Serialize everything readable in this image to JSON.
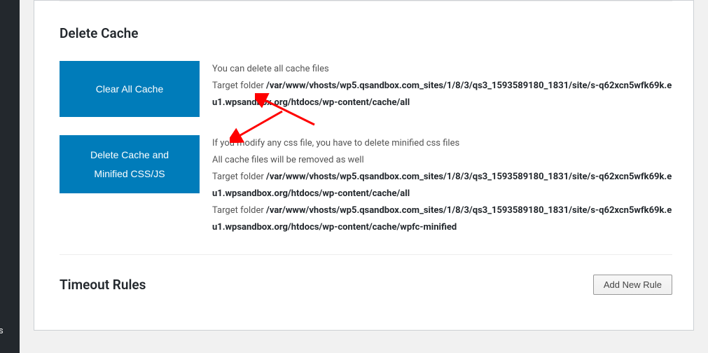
{
  "sidebar": {
    "partial_text": "s"
  },
  "sections": {
    "delete_cache": {
      "title": "Delete Cache",
      "clear_all": {
        "button_label": "Clear All Cache",
        "intro": "You can delete all cache files",
        "target_label": "Target folder ",
        "target_path": "/var/www/vhosts/wp5.qsandbox.com_sites/1/8/3/qs3_1593589180_1831/site/s-q62xcn5wfk69k.eu1.wpsandbox.org/htdocs/wp-content/cache/all"
      },
      "delete_minified": {
        "button_label": "Delete Cache and Minified CSS/JS",
        "intro1": "If you modify any css file, you have to delete minified css files",
        "intro2": "All cache files will be removed as well",
        "target_label1": "Target folder ",
        "target_path1": "/var/www/vhosts/wp5.qsandbox.com_sites/1/8/3/qs3_1593589180_1831/site/s-q62xcn5wfk69k.eu1.wpsandbox.org/htdocs/wp-content/cache/all",
        "target_label2": "Target folder ",
        "target_path2": "/var/www/vhosts/wp5.qsandbox.com_sites/1/8/3/qs3_1593589180_1831/site/s-q62xcn5wfk69k.eu1.wpsandbox.org/htdocs/wp-content/cache/wpfc-minified"
      }
    },
    "timeout_rules": {
      "title": "Timeout Rules",
      "add_button_label": "Add New Rule"
    }
  }
}
